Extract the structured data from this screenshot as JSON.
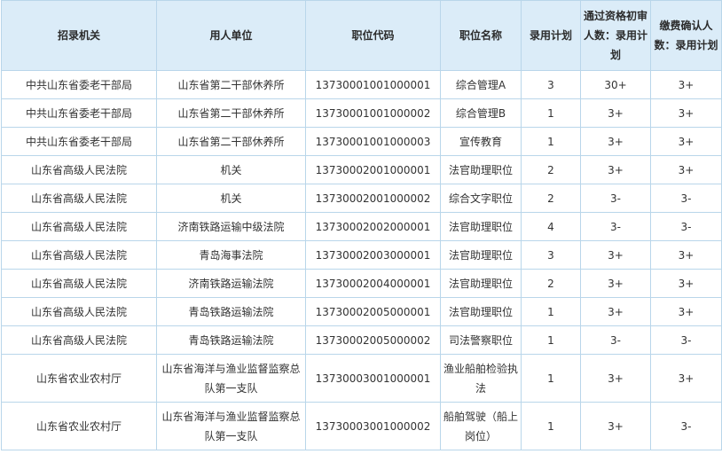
{
  "headers": [
    "招录机关",
    "用人单位",
    "职位代码",
    "职位名称",
    "录用计划",
    "通过资格初审人数：录用计划",
    "缴费确认人数：录用计划"
  ],
  "rows": [
    [
      "中共山东省委老干部局",
      "山东省第二干部休养所",
      "13730001001000001",
      "综合管理A",
      "3",
      "30+",
      "3+"
    ],
    [
      "中共山东省委老干部局",
      "山东省第二干部休养所",
      "13730001001000002",
      "综合管理B",
      "1",
      "3+",
      "3+"
    ],
    [
      "中共山东省委老干部局",
      "山东省第二干部休养所",
      "13730001001000003",
      "宣传教育",
      "1",
      "3+",
      "3+"
    ],
    [
      "山东省高级人民法院",
      "机关",
      "13730002001000001",
      "法官助理职位",
      "2",
      "3+",
      "3+"
    ],
    [
      "山东省高级人民法院",
      "机关",
      "13730002001000002",
      "综合文字职位",
      "2",
      "3-",
      "3-"
    ],
    [
      "山东省高级人民法院",
      "济南铁路运输中级法院",
      "13730002002000001",
      "法官助理职位",
      "4",
      "3-",
      "3-"
    ],
    [
      "山东省高级人民法院",
      "青岛海事法院",
      "13730002003000001",
      "法官助理职位",
      "3",
      "3+",
      "3+"
    ],
    [
      "山东省高级人民法院",
      "济南铁路运输法院",
      "13730002004000001",
      "法官助理职位",
      "2",
      "3+",
      "3+"
    ],
    [
      "山东省高级人民法院",
      "青岛铁路运输法院",
      "13730002005000001",
      "法官助理职位",
      "1",
      "3+",
      "3+"
    ],
    [
      "山东省高级人民法院",
      "青岛铁路运输法院",
      "13730002005000002",
      "司法警察职位",
      "1",
      "3-",
      "3-"
    ],
    [
      "山东省农业农村厅",
      "山东省海洋与渔业监督监察总队第一支队",
      "13730003001000001",
      "渔业船舶检验执法",
      "1",
      "3+",
      "3+"
    ],
    [
      "山东省农业农村厅",
      "山东省海洋与渔业监督监察总队第一支队",
      "13730003001000002",
      "船舶驾驶（船上岗位）",
      "1",
      "3+",
      "3-"
    ]
  ]
}
